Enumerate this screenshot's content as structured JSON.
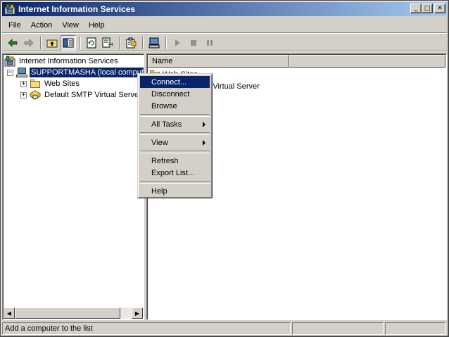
{
  "window": {
    "title": "Internet Information Services"
  },
  "caption": {
    "minimize": "_",
    "maximize": "□",
    "close": "✕"
  },
  "menu": {
    "items": [
      "File",
      "Action",
      "View",
      "Help"
    ]
  },
  "toolbar": {
    "icons": [
      "back-arrow-icon",
      "forward-arrow-icon",
      "up-folder-icon",
      "show-hide-tree-icon",
      "refresh-icon",
      "export-list-icon",
      "properties-icon",
      "computer-icon",
      "play-icon",
      "stop-icon",
      "pause-icon"
    ]
  },
  "tree": {
    "root": "Internet Information Services",
    "computer": "SUPPORTMASHA (local computer)",
    "children": [
      "Web Sites",
      "Default SMTP Virtual Server"
    ]
  },
  "list": {
    "columns": [
      "Name"
    ],
    "rows": [
      "Web Sites",
      "Default SMTP Virtual Server"
    ]
  },
  "context_menu": {
    "items": [
      "Connect...",
      "Disconnect",
      "Browse",
      "All Tasks",
      "View",
      "Refresh",
      "Export List...",
      "Help"
    ]
  },
  "status": {
    "text": "Add a computer to the list"
  },
  "colors": {
    "selection": "#0a246a",
    "face": "#d4d0c8",
    "title_end": "#a6caf0"
  }
}
